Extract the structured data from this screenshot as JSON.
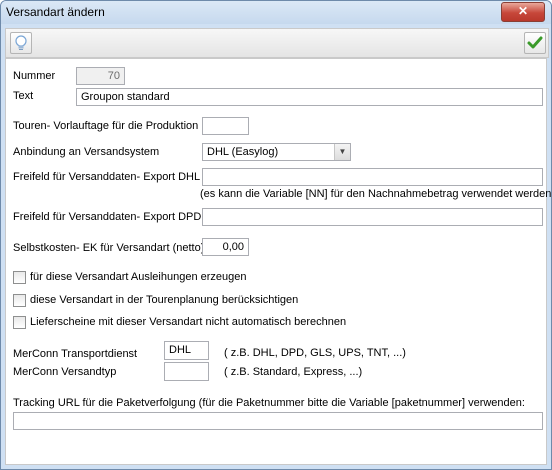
{
  "window": {
    "title": "Versandart ändern",
    "close_label": "✕"
  },
  "toolbar": {
    "hint_icon": "lightbulb-icon",
    "ok_icon": "checkmark-icon"
  },
  "form": {
    "nummer_label": "Nummer",
    "nummer_value": "70",
    "text_label": "Text",
    "text_value": "Groupon standard",
    "touren_label": "Touren- Vorlauftage für die Produktion",
    "touren_value": "",
    "anbindung_label": "Anbindung an Versandsystem",
    "anbindung_value": "DHL (Easylog)",
    "freifeld_dhl_label": "Freifeld für Versanddaten- Export DHL",
    "freifeld_dhl_value": "",
    "freifeld_dhl_hint": "(es kann die Variable [NN] für den Nachnahmebetrag verwendet werden)",
    "freifeld_dpd_label": "Freifeld für Versanddaten- Export DPD",
    "freifeld_dpd_value": "",
    "selbstkosten_label": "Selbstkosten- EK für Versandart (netto)",
    "selbstkosten_value": "0,00"
  },
  "checkboxes": [
    {
      "label": "für diese Versandart Ausleihungen erzeugen",
      "checked": false
    },
    {
      "label": "diese Versandart in der Tourenplanung berücksichtigen",
      "checked": false
    },
    {
      "label": "Lieferscheine mit dieser Versandart nicht automatisch berechnen",
      "checked": false
    }
  ],
  "merconn": {
    "transportdienst_label": "MerConn Transportdienst",
    "transportdienst_value": "DHL",
    "transportdienst_hint": "( z.B. DHL, DPD, GLS, UPS, TNT, ...)",
    "versandtyp_label": "MerConn Versandtyp",
    "versandtyp_value": "",
    "versandtyp_hint": "( z.B. Standard, Express, ...)"
  },
  "tracking": {
    "label": "Tracking URL für die Paketverfolgung (für die Paketnummer bitte die Variable [paketnummer] verwenden:",
    "value": ""
  },
  "colors": {
    "titlebar": "#c6d9ee",
    "close_button": "#c7473a",
    "check_green": "#3a9a2a"
  }
}
